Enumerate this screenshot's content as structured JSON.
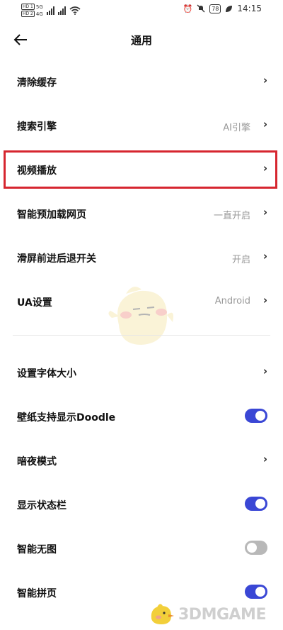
{
  "status_bar": {
    "sim1": "HD 1",
    "sim1_net": "5G",
    "sim2": "HD 2",
    "sim2_net": "4G",
    "battery": "78",
    "time": "14:15"
  },
  "header": {
    "title": "通用"
  },
  "rows": [
    {
      "label": "清除缓存",
      "value": "",
      "control": "chevron"
    },
    {
      "label": "搜索引擎",
      "value": "AI引擎",
      "control": "chevron"
    },
    {
      "label": "视频播放",
      "value": "",
      "control": "chevron",
      "highlighted": true
    },
    {
      "label": "智能预加载网页",
      "value": "一直开启",
      "control": "chevron"
    },
    {
      "label": "滑屏前进后退开关",
      "value": "开启",
      "control": "chevron"
    },
    {
      "label": "UA设置",
      "value": "Android",
      "control": "chevron"
    },
    {
      "label": "设置字体大小",
      "value": "",
      "control": "chevron"
    },
    {
      "label": "壁纸支持显示Doodle",
      "control": "toggle",
      "on": true
    },
    {
      "label": "暗夜模式",
      "value": "",
      "control": "chevron"
    },
    {
      "label": "显示状态栏",
      "control": "toggle",
      "on": true
    },
    {
      "label": "智能无图",
      "control": "toggle",
      "on": false
    },
    {
      "label": "智能拼页",
      "control": "toggle",
      "on": true
    }
  ],
  "chevron_glyph": "›",
  "colors": {
    "toggle_on": "#3a47d5",
    "toggle_off": "#b8b8b8",
    "highlight": "#d6262f"
  },
  "watermark": {
    "text": "3DMGAME"
  }
}
